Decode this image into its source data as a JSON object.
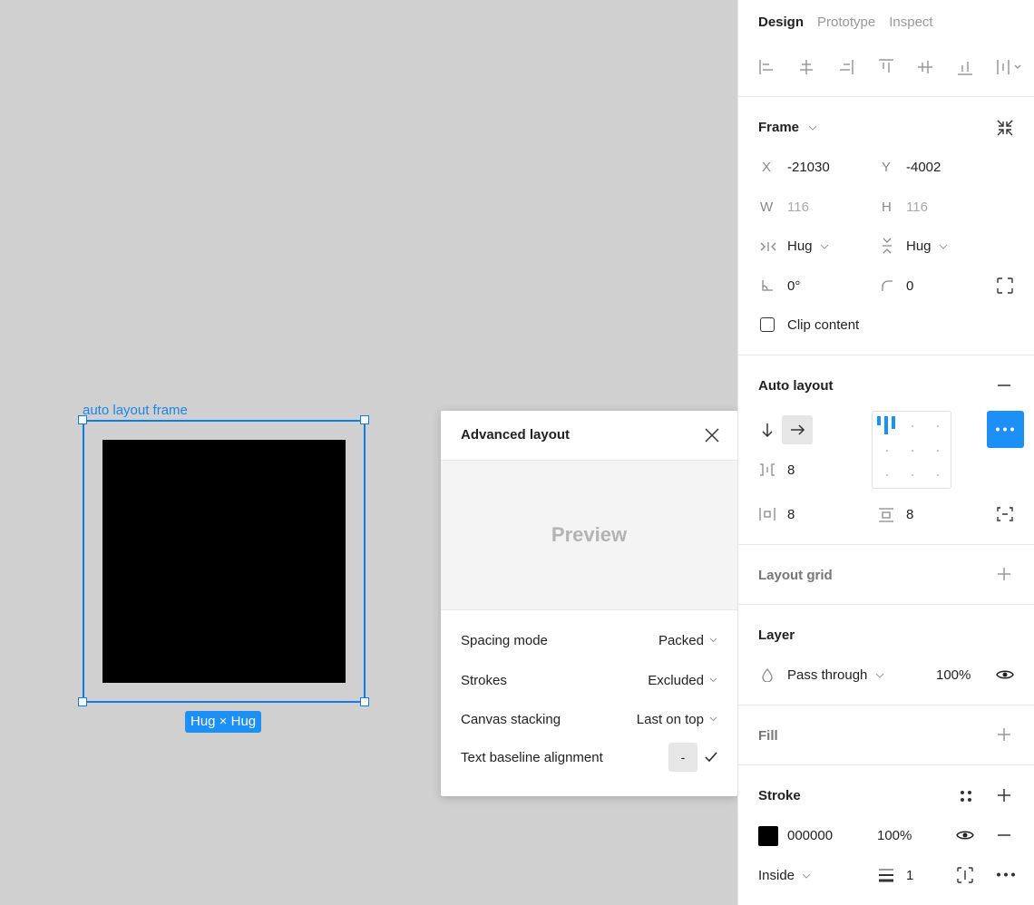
{
  "canvas": {
    "frame_label": "auto layout frame",
    "size_badge": "Hug × Hug"
  },
  "advanced_layout": {
    "title": "Advanced layout",
    "preview_label": "Preview",
    "rows": [
      {
        "label": "Spacing mode",
        "value": "Packed"
      },
      {
        "label": "Strokes",
        "value": "Excluded"
      },
      {
        "label": "Canvas stacking",
        "value": "Last on top"
      }
    ],
    "baseline": {
      "label": "Text baseline alignment",
      "toggle_text": "-"
    }
  },
  "panel": {
    "tabs": [
      "Design",
      "Prototype",
      "Inspect"
    ],
    "active_tab": "Design",
    "frame": {
      "title": "Frame",
      "x_label": "X",
      "x": "-21030",
      "y_label": "Y",
      "y": "-4002",
      "w_label": "W",
      "w": "116",
      "h_label": "H",
      "h": "116",
      "h_sizing": "Hug",
      "v_sizing": "Hug",
      "rotation": "0°",
      "radius": "0",
      "clip_label": "Clip content",
      "clip_checked": false
    },
    "auto_layout": {
      "title": "Auto layout",
      "direction": "horizontal",
      "gap": "8",
      "h_padding": "8",
      "v_padding": "8"
    },
    "layout_grid": {
      "title": "Layout grid"
    },
    "layer": {
      "title": "Layer",
      "blend": "Pass through",
      "opacity": "100%"
    },
    "fill": {
      "title": "Fill"
    },
    "stroke": {
      "title": "Stroke",
      "color_hex": "000000",
      "opacity": "100%",
      "position": "Inside",
      "weight": "1"
    }
  },
  "colors": {
    "accent": "#1d90f5",
    "selection": "#0d7ce6"
  }
}
